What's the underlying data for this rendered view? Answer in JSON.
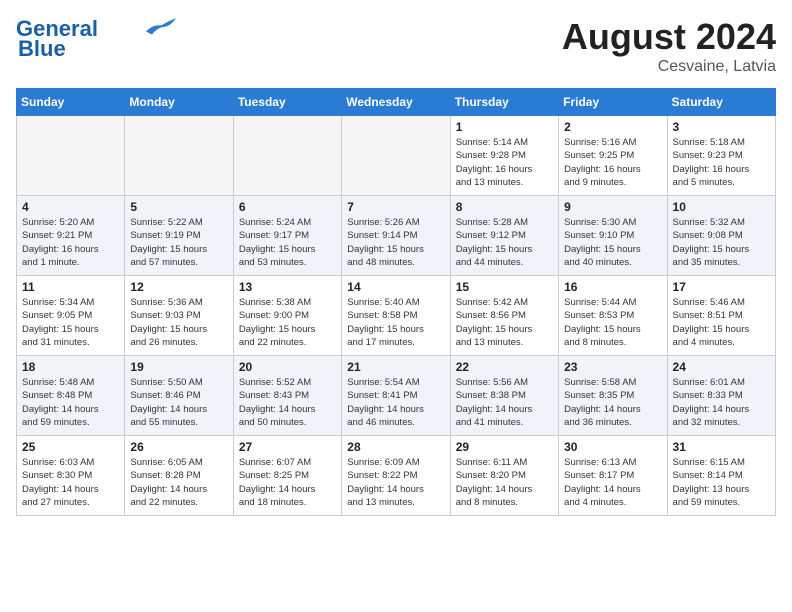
{
  "header": {
    "logo_line1": "General",
    "logo_line2": "Blue",
    "month_year": "August 2024",
    "location": "Cesvaine, Latvia"
  },
  "days_of_week": [
    "Sunday",
    "Monday",
    "Tuesday",
    "Wednesday",
    "Thursday",
    "Friday",
    "Saturday"
  ],
  "weeks": [
    [
      {
        "num": "",
        "info": "",
        "empty": true
      },
      {
        "num": "",
        "info": "",
        "empty": true
      },
      {
        "num": "",
        "info": "",
        "empty": true
      },
      {
        "num": "",
        "info": "",
        "empty": true
      },
      {
        "num": "1",
        "info": "Sunrise: 5:14 AM\nSunset: 9:28 PM\nDaylight: 16 hours\nand 13 minutes."
      },
      {
        "num": "2",
        "info": "Sunrise: 5:16 AM\nSunset: 9:25 PM\nDaylight: 16 hours\nand 9 minutes."
      },
      {
        "num": "3",
        "info": "Sunrise: 5:18 AM\nSunset: 9:23 PM\nDaylight: 16 hours\nand 5 minutes."
      }
    ],
    [
      {
        "num": "4",
        "info": "Sunrise: 5:20 AM\nSunset: 9:21 PM\nDaylight: 16 hours\nand 1 minute."
      },
      {
        "num": "5",
        "info": "Sunrise: 5:22 AM\nSunset: 9:19 PM\nDaylight: 15 hours\nand 57 minutes."
      },
      {
        "num": "6",
        "info": "Sunrise: 5:24 AM\nSunset: 9:17 PM\nDaylight: 15 hours\nand 53 minutes."
      },
      {
        "num": "7",
        "info": "Sunrise: 5:26 AM\nSunset: 9:14 PM\nDaylight: 15 hours\nand 48 minutes."
      },
      {
        "num": "8",
        "info": "Sunrise: 5:28 AM\nSunset: 9:12 PM\nDaylight: 15 hours\nand 44 minutes."
      },
      {
        "num": "9",
        "info": "Sunrise: 5:30 AM\nSunset: 9:10 PM\nDaylight: 15 hours\nand 40 minutes."
      },
      {
        "num": "10",
        "info": "Sunrise: 5:32 AM\nSunset: 9:08 PM\nDaylight: 15 hours\nand 35 minutes."
      }
    ],
    [
      {
        "num": "11",
        "info": "Sunrise: 5:34 AM\nSunset: 9:05 PM\nDaylight: 15 hours\nand 31 minutes."
      },
      {
        "num": "12",
        "info": "Sunrise: 5:36 AM\nSunset: 9:03 PM\nDaylight: 15 hours\nand 26 minutes."
      },
      {
        "num": "13",
        "info": "Sunrise: 5:38 AM\nSunset: 9:00 PM\nDaylight: 15 hours\nand 22 minutes."
      },
      {
        "num": "14",
        "info": "Sunrise: 5:40 AM\nSunset: 8:58 PM\nDaylight: 15 hours\nand 17 minutes."
      },
      {
        "num": "15",
        "info": "Sunrise: 5:42 AM\nSunset: 8:56 PM\nDaylight: 15 hours\nand 13 minutes."
      },
      {
        "num": "16",
        "info": "Sunrise: 5:44 AM\nSunset: 8:53 PM\nDaylight: 15 hours\nand 8 minutes."
      },
      {
        "num": "17",
        "info": "Sunrise: 5:46 AM\nSunset: 8:51 PM\nDaylight: 15 hours\nand 4 minutes."
      }
    ],
    [
      {
        "num": "18",
        "info": "Sunrise: 5:48 AM\nSunset: 8:48 PM\nDaylight: 14 hours\nand 59 minutes."
      },
      {
        "num": "19",
        "info": "Sunrise: 5:50 AM\nSunset: 8:46 PM\nDaylight: 14 hours\nand 55 minutes."
      },
      {
        "num": "20",
        "info": "Sunrise: 5:52 AM\nSunset: 8:43 PM\nDaylight: 14 hours\nand 50 minutes."
      },
      {
        "num": "21",
        "info": "Sunrise: 5:54 AM\nSunset: 8:41 PM\nDaylight: 14 hours\nand 46 minutes."
      },
      {
        "num": "22",
        "info": "Sunrise: 5:56 AM\nSunset: 8:38 PM\nDaylight: 14 hours\nand 41 minutes."
      },
      {
        "num": "23",
        "info": "Sunrise: 5:58 AM\nSunset: 8:35 PM\nDaylight: 14 hours\nand 36 minutes."
      },
      {
        "num": "24",
        "info": "Sunrise: 6:01 AM\nSunset: 8:33 PM\nDaylight: 14 hours\nand 32 minutes."
      }
    ],
    [
      {
        "num": "25",
        "info": "Sunrise: 6:03 AM\nSunset: 8:30 PM\nDaylight: 14 hours\nand 27 minutes."
      },
      {
        "num": "26",
        "info": "Sunrise: 6:05 AM\nSunset: 8:28 PM\nDaylight: 14 hours\nand 22 minutes."
      },
      {
        "num": "27",
        "info": "Sunrise: 6:07 AM\nSunset: 8:25 PM\nDaylight: 14 hours\nand 18 minutes."
      },
      {
        "num": "28",
        "info": "Sunrise: 6:09 AM\nSunset: 8:22 PM\nDaylight: 14 hours\nand 13 minutes."
      },
      {
        "num": "29",
        "info": "Sunrise: 6:11 AM\nSunset: 8:20 PM\nDaylight: 14 hours\nand 8 minutes."
      },
      {
        "num": "30",
        "info": "Sunrise: 6:13 AM\nSunset: 8:17 PM\nDaylight: 14 hours\nand 4 minutes."
      },
      {
        "num": "31",
        "info": "Sunrise: 6:15 AM\nSunset: 8:14 PM\nDaylight: 13 hours\nand 59 minutes."
      }
    ]
  ]
}
